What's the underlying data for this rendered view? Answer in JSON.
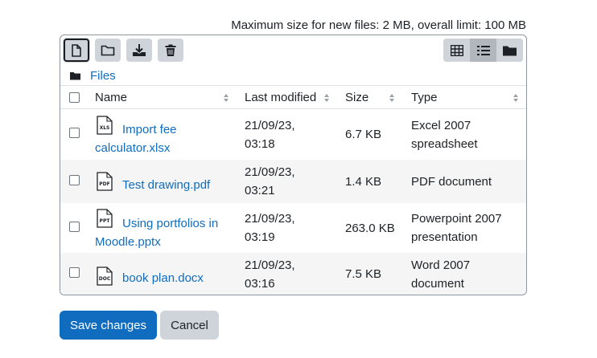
{
  "limit_text": "Maximum size for new files: 2 MB, overall limit: 100 MB",
  "toolbar": {
    "add_file_icon": "file-icon",
    "create_folder_icon": "folder-icon",
    "download_icon": "download-icon",
    "delete_icon": "trash-icon",
    "view_icons": "grid-icon",
    "view_list": "list-icon",
    "view_tree": "folder-tree-icon"
  },
  "path": {
    "label": "Files"
  },
  "table": {
    "headers": {
      "name": "Name",
      "modified": "Last modified",
      "size": "Size",
      "type": "Type"
    },
    "rows": [
      {
        "icon": "XLS",
        "name_line1": "Import fee",
        "name_line2": "calculator.xlsx",
        "modified_date": "21/09/23,",
        "modified_time": "03:18",
        "size": "6.7 KB",
        "type_line1": "Excel 2007",
        "type_line2": "spreadsheet"
      },
      {
        "icon": "PDF",
        "name_line1": "Test drawing.pdf",
        "name_line2": "",
        "modified_date": "21/09/23,",
        "modified_time": "03:21",
        "size": "1.4 KB",
        "type_line1": "PDF document",
        "type_line2": ""
      },
      {
        "icon": "PPT",
        "name_line1": "Using portfolios in",
        "name_line2": "Moodle.pptx",
        "modified_date": "21/09/23,",
        "modified_time": "03:19",
        "size": "263.0 KB",
        "type_line1": "Powerpoint 2007",
        "type_line2": "presentation"
      },
      {
        "icon": "DOC",
        "name_line1": "book plan.docx",
        "name_line2": "",
        "modified_date": "21/09/23,",
        "modified_time": "03:16",
        "size": "7.5 KB",
        "type_line1": "Word 2007",
        "type_line2": "document"
      }
    ]
  },
  "buttons": {
    "save": "Save changes",
    "cancel": "Cancel"
  },
  "colors": {
    "link": "#0f6cbf",
    "primary": "#0f6cbf",
    "secondary": "#ced4da",
    "border": "#8f959e"
  }
}
